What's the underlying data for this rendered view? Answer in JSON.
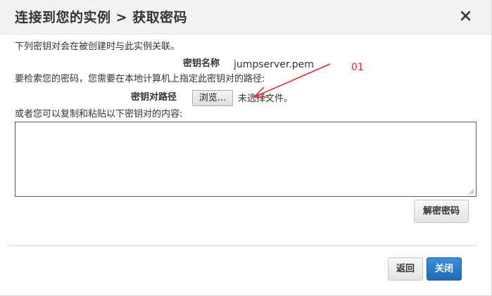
{
  "dialog": {
    "title": "连接到您的实例 > 获取密码",
    "close_icon": "close-icon"
  },
  "body": {
    "intro_text": "下列密钥对会在被创建时与此实例关联。",
    "key_name_label": "密钥名称",
    "key_name_value": "jumpserver.pem",
    "retrieve_text": "要检索您的密码，您需要在本地计算机上指定此密钥对的路径:",
    "key_path_label": "密钥对路径",
    "browse_button": "浏览...",
    "no_file_text": "未选择文件。",
    "paste_text": "或者您可以复制和粘贴以下密钥对的内容:",
    "key_content_value": "",
    "decrypt_button": "解密密码"
  },
  "footer": {
    "back_button": "返回",
    "close_button": "关闭"
  },
  "annotation": {
    "label": "01",
    "color": "#d9262b"
  },
  "colors": {
    "primary_button": "#1e6ab7",
    "header_background": "#f2f2f2"
  }
}
